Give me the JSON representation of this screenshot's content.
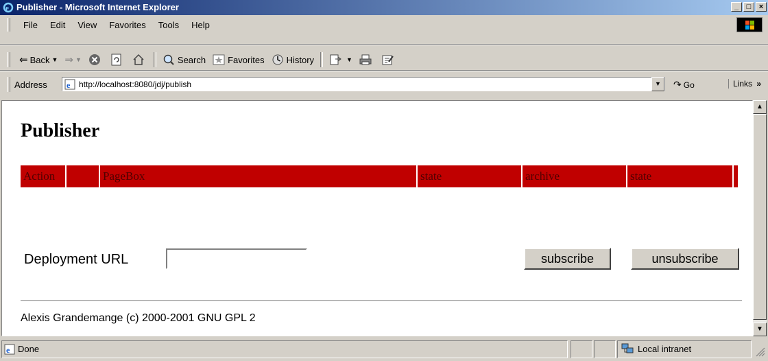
{
  "window": {
    "title": "Publisher - Microsoft Internet Explorer",
    "min": "_",
    "max": "□",
    "close": "×"
  },
  "menu": [
    {
      "label": "File"
    },
    {
      "label": "Edit"
    },
    {
      "label": "View"
    },
    {
      "label": "Favorites"
    },
    {
      "label": "Tools"
    },
    {
      "label": "Help"
    }
  ],
  "toolbar": {
    "back": "Back",
    "search": "Search",
    "favorites": "Favorites",
    "history": "History"
  },
  "address": {
    "label": "Address",
    "url": "http://localhost:8080/jdj/publish",
    "go": "Go",
    "links": "Links"
  },
  "page": {
    "title": "Publisher",
    "table_headers": [
      "Action",
      "",
      "PageBox",
      "state",
      "archive",
      "state",
      ""
    ],
    "deployment_label": "Deployment URL",
    "deployment_value": "",
    "subscribe": "subscribe",
    "unsubscribe": "unsubscribe",
    "footer": "Alexis Grandemange (c) 2000-2001 GNU GPL 2"
  },
  "status": {
    "text": "Done",
    "zone": "Local intranet"
  },
  "colors": {
    "header_red": "#c00000",
    "title_blue": "#0a246a"
  }
}
